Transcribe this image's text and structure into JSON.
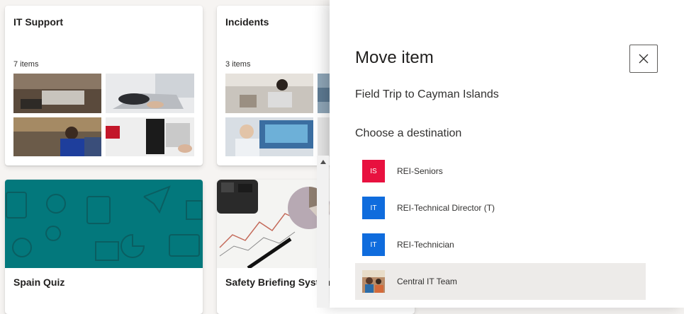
{
  "cards": [
    {
      "title": "IT Support",
      "count": "7 items"
    },
    {
      "title": "Incidents",
      "count": "3 items"
    },
    {
      "title": "Spain Quiz"
    },
    {
      "title": "Safety Briefing System"
    }
  ],
  "panel": {
    "title": "Move item",
    "item_name": "Field Trip to Cayman Islands",
    "choose_label": "Choose a destination",
    "close_icon": "close-icon",
    "destinations": [
      {
        "initials": "IS",
        "label": "REI-Seniors",
        "color": "#e8113f"
      },
      {
        "initials": "IT",
        "label": "REI-Technical Director (T)",
        "color": "#0f6cdd"
      },
      {
        "initials": "IT",
        "label": "REI-Technician",
        "color": "#0f6cdd"
      },
      {
        "initials": "",
        "label": "Central IT Team",
        "color": "",
        "selected": true
      }
    ]
  },
  "colors": {
    "accent_teal": "#03787c",
    "highlight": "#edebe9"
  }
}
